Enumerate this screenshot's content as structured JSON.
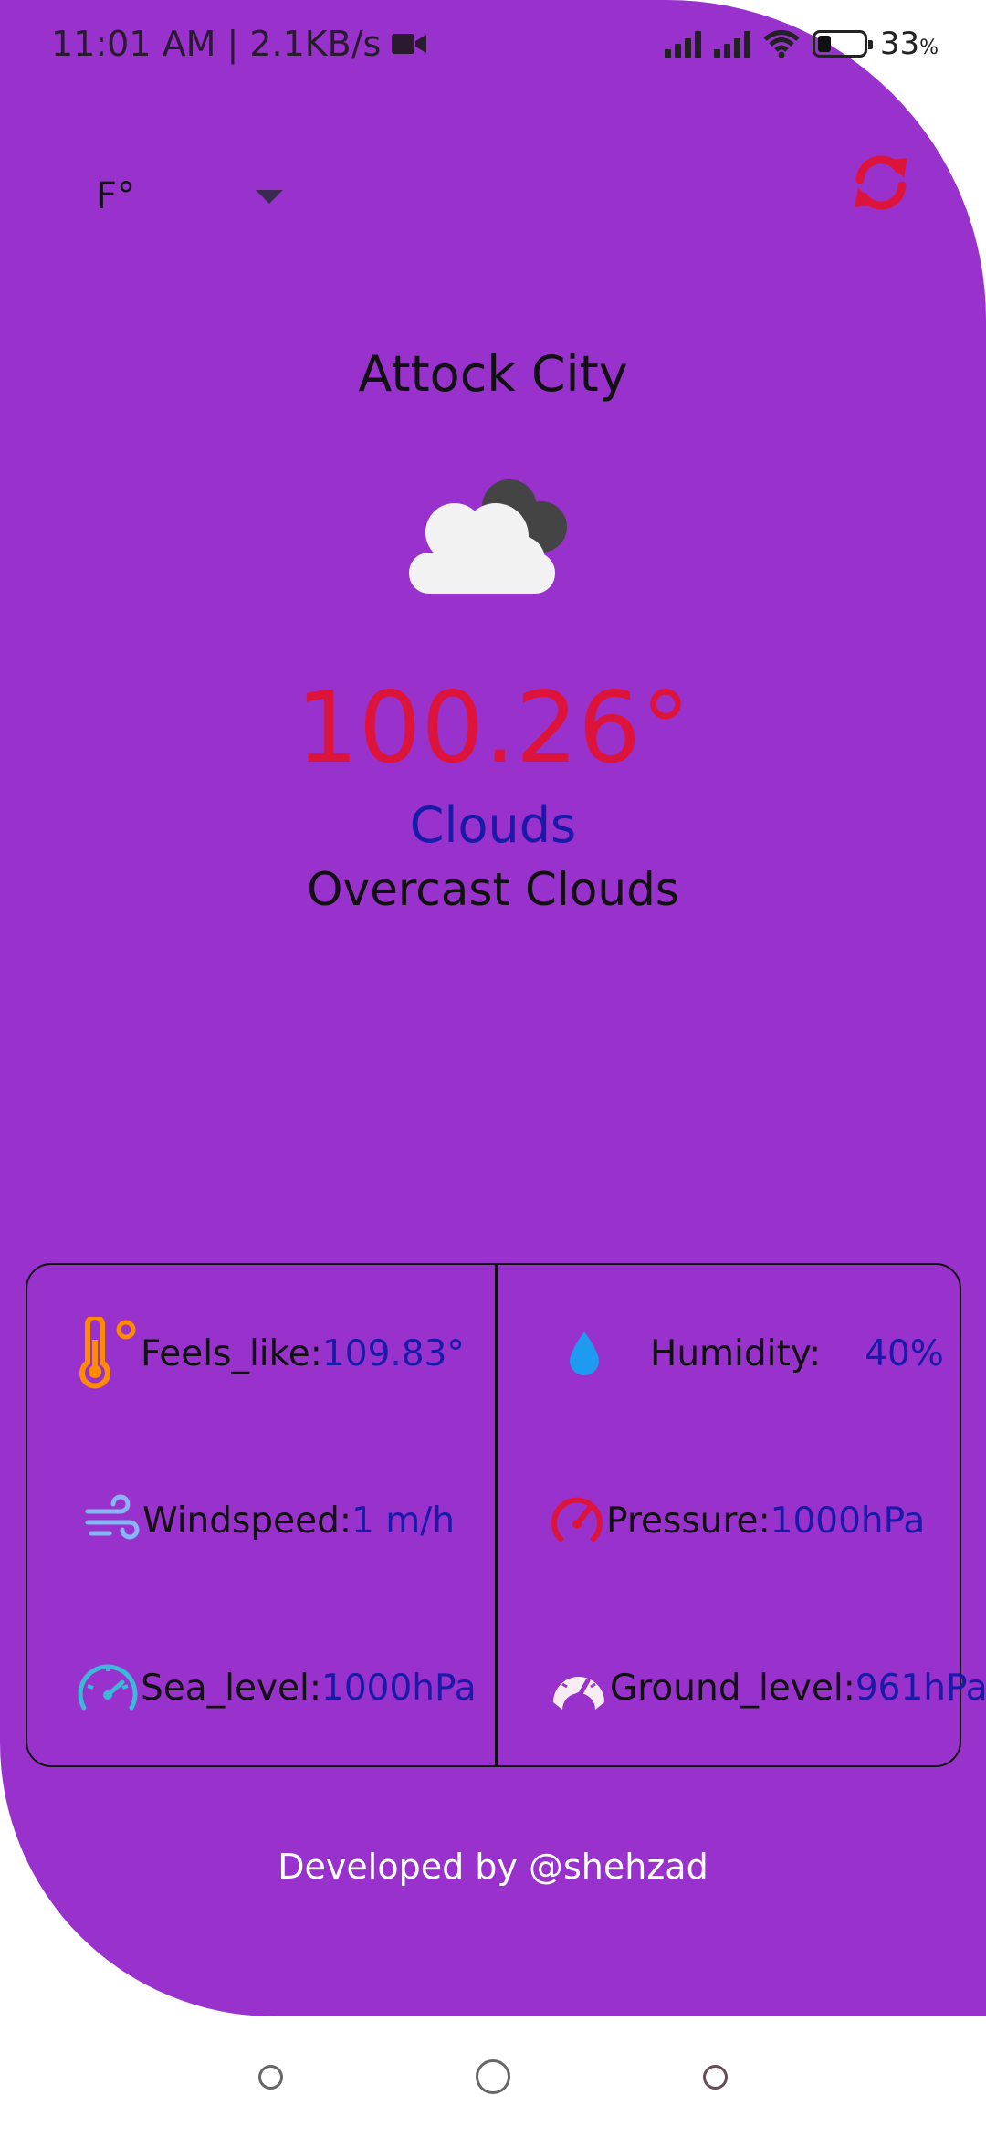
{
  "status_bar": {
    "time_speed": "11:01 AM | 2.1KB/s",
    "battery_pct": "33",
    "battery_unit": "%",
    "icons": [
      "video-camera-icon",
      "signal-icon",
      "signal-icon",
      "wifi-icon",
      "battery-icon"
    ]
  },
  "controls": {
    "unit_selected": "F°",
    "refresh_icon": "refresh-icon",
    "refresh_color": "#DC143C"
  },
  "weather": {
    "city": "Attock City",
    "icon": "overcast-clouds-icon",
    "temperature": "100.26°",
    "main": "Clouds",
    "description": "Overcast Clouds"
  },
  "details": {
    "feels_like": {
      "label": "Feels_like: ",
      "value": "109.83°",
      "icon": "thermometer-icon"
    },
    "humidity": {
      "label": "Humidity:",
      "value": "40%",
      "icon": "water-drop-icon"
    },
    "windspeed": {
      "label": "Windspeed: ",
      "value": "1 m/h",
      "icon": "wind-icon"
    },
    "pressure": {
      "label": "Pressure: ",
      "value": "1000hPa",
      "icon": "pressure-gauge-icon"
    },
    "sea_level": {
      "label": "Sea_level: ",
      "value": "1000hPa",
      "icon": "speedometer-icon"
    },
    "ground_level": {
      "label": "Ground_level: ",
      "value": "961hPa",
      "icon": "dashboard-gauge-icon"
    }
  },
  "footer": {
    "text": "Developed by @shehzad"
  },
  "theme": {
    "background": "#9932CC",
    "temperature_color": "#DC143C",
    "value_color": "#1A1AA8"
  }
}
